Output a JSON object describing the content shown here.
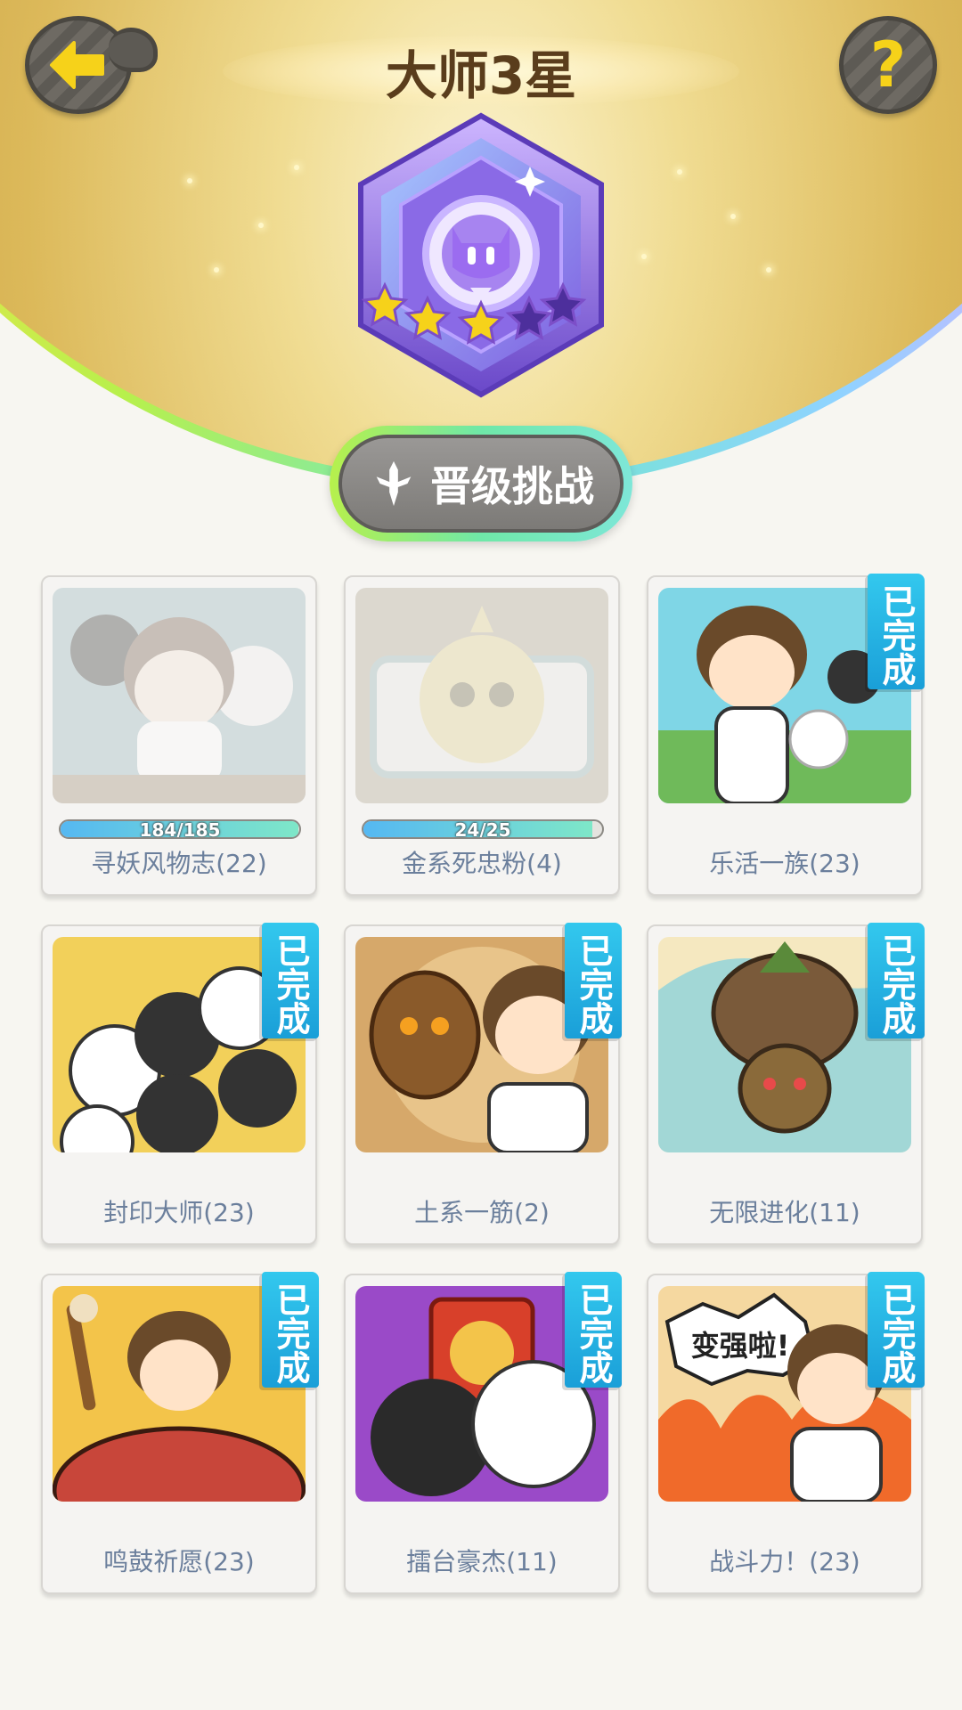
{
  "header": {
    "title": "大师3星",
    "back_icon": "back-arrow-icon",
    "help_label": "?",
    "rank": {
      "stars_total": 5,
      "stars_filled": 3
    }
  },
  "challenge_button": {
    "label": "晋级挑战",
    "icon": "sword-icon"
  },
  "colors": {
    "accent": "#f6d21a",
    "done_tag": "#1a9fd8",
    "label": "#6b7f9c",
    "gold": "#c9a142"
  },
  "achievements": [
    {
      "label": "寻妖风物志(22)",
      "done": false,
      "progress_text": "184/185",
      "progress": 0.995,
      "art": "girl-spirits"
    },
    {
      "label": "金系死忠粉(4)",
      "done": false,
      "progress_text": "24/25",
      "progress": 0.96,
      "art": "gold-spirit"
    },
    {
      "label": "乐活一族(23)",
      "done": true,
      "done_label": "已完成",
      "art": "boy-park"
    },
    {
      "label": "封印大师(23)",
      "done": true,
      "done_label": "已完成",
      "art": "spirit-crowd"
    },
    {
      "label": "土系一筋(2)",
      "done": true,
      "done_label": "已完成",
      "art": "earth-spirit"
    },
    {
      "label": "无限进化(11)",
      "done": true,
      "done_label": "已完成",
      "art": "evolution"
    },
    {
      "label": "鸣鼓祈愿(23)",
      "done": true,
      "done_label": "已完成",
      "art": "drum"
    },
    {
      "label": "擂台豪杰(11)",
      "done": true,
      "done_label": "已完成",
      "art": "arena"
    },
    {
      "label": "战斗力！(23)",
      "done": true,
      "done_label": "已完成",
      "art": "power-up",
      "speech": "变强啦!"
    }
  ]
}
